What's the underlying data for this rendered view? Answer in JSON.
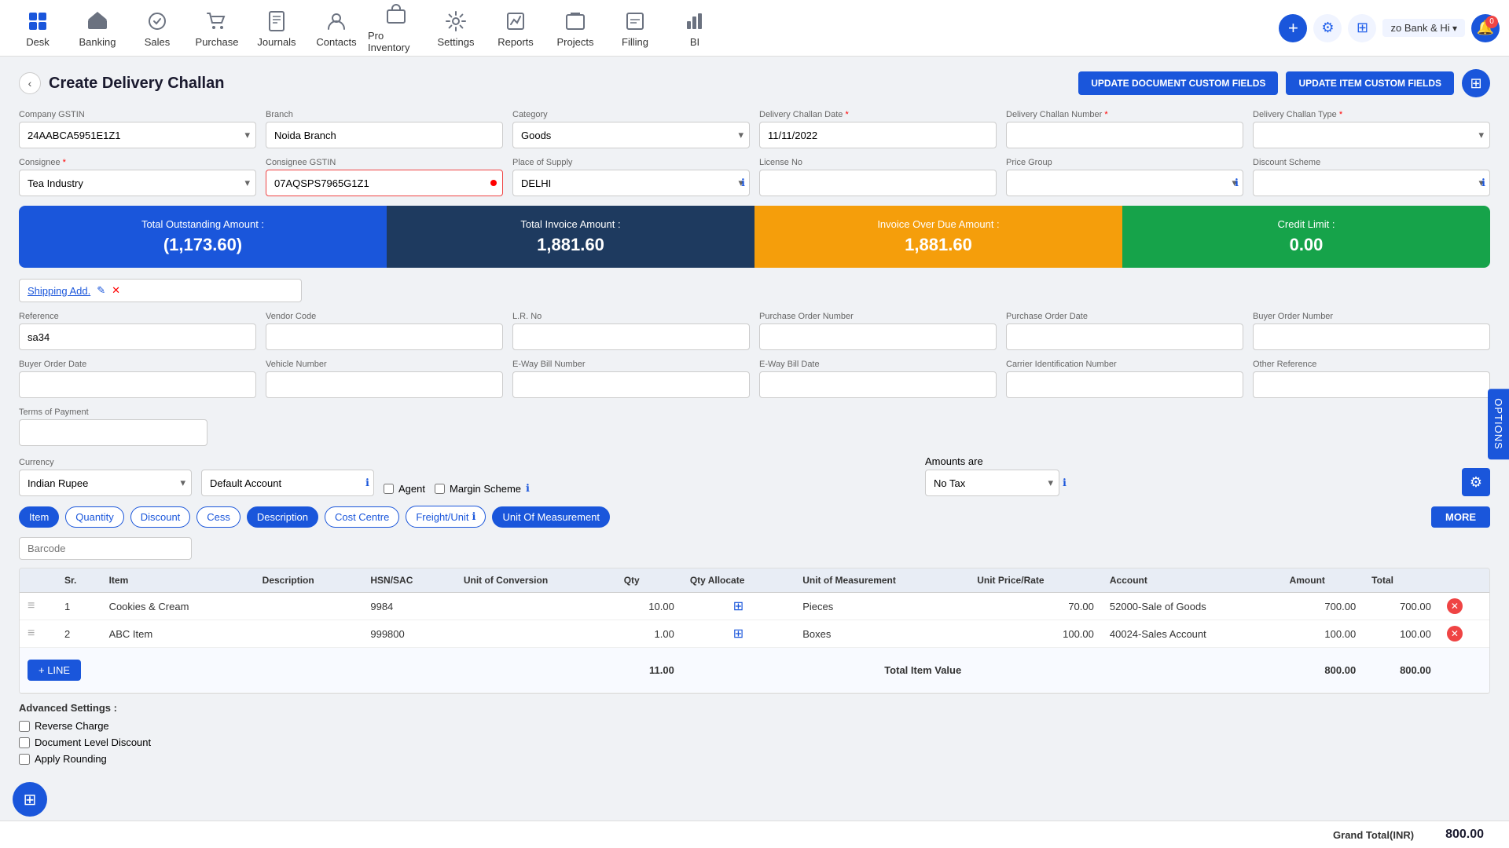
{
  "nav": {
    "items": [
      {
        "id": "desk",
        "label": "Desk",
        "icon": "🏠"
      },
      {
        "id": "banking",
        "label": "Banking",
        "icon": "🏦"
      },
      {
        "id": "sales",
        "label": "Sales",
        "icon": "🏷️"
      },
      {
        "id": "purchase",
        "label": "Purchase",
        "icon": "🛒"
      },
      {
        "id": "journals",
        "label": "Journals",
        "icon": "📋"
      },
      {
        "id": "contacts",
        "label": "Contacts",
        "icon": "👤"
      },
      {
        "id": "pro-inventory",
        "label": "Pro Inventory",
        "icon": "📦"
      },
      {
        "id": "settings",
        "label": "Settings",
        "icon": "⚙️"
      },
      {
        "id": "reports",
        "label": "Reports",
        "icon": "📊"
      },
      {
        "id": "projects",
        "label": "Projects",
        "icon": "📁"
      },
      {
        "id": "filling",
        "label": "Filling",
        "icon": "🗂️"
      },
      {
        "id": "bi",
        "label": "BI",
        "icon": "📈"
      }
    ],
    "company": "zo Bank & Hi",
    "badge_count": "0"
  },
  "page": {
    "title": "Create Delivery Challan",
    "back_label": "‹"
  },
  "buttons": {
    "update_doc": "UPDATE DOCUMENT CUSTOM FIELDS",
    "update_item": "UPDATE ITEM CUSTOM FIELDS",
    "options": "OPTIONS",
    "more": "MORE",
    "add_line": "+ LINE"
  },
  "form": {
    "company_gstin_label": "Company GSTIN",
    "company_gstin_value": "24AABCA5951E1Z1",
    "branch_label": "Branch",
    "branch_value": "Noida Branch",
    "category_label": "Category",
    "category_value": "Goods",
    "delivery_challan_date_label": "Delivery Challan Date",
    "delivery_challan_date_value": "11/11/2022",
    "delivery_challan_number_label": "Delivery Challan Number",
    "delivery_challan_number_value": "",
    "delivery_challan_type_label": "Delivery Challan Type",
    "delivery_challan_type_value": "",
    "consignee_label": "Consignee",
    "consignee_value": "Tea Industry",
    "consignee_gstin_label": "Consignee GSTIN",
    "consignee_gstin_value": "07AQSPS7965G1Z1",
    "place_of_supply_label": "Place of Supply",
    "place_of_supply_value": "DELHI",
    "license_no_label": "License No",
    "license_no_value": "",
    "price_group_label": "Price Group",
    "price_group_value": "",
    "discount_scheme_label": "Discount Scheme",
    "discount_scheme_value": "",
    "reference_label": "Reference",
    "reference_value": "sa34",
    "vendor_code_label": "Vendor Code",
    "vendor_code_value": "",
    "lr_no_label": "L.R. No",
    "lr_no_value": "",
    "purchase_order_number_label": "Purchase Order Number",
    "purchase_order_number_value": "",
    "purchase_order_date_label": "Purchase Order Date",
    "purchase_order_date_value": "",
    "buyer_order_number_label": "Buyer Order Number",
    "buyer_order_number_value": "",
    "buyer_order_date_label": "Buyer Order Date",
    "buyer_order_date_value": "",
    "vehicle_number_label": "Vehicle Number",
    "vehicle_number_value": "",
    "eway_bill_number_label": "E-Way Bill Number",
    "eway_bill_number_value": "",
    "eway_bill_date_label": "E-Way Bill Date",
    "eway_bill_date_value": "",
    "carrier_id_label": "Carrier Identification Number",
    "carrier_id_value": "",
    "other_reference_label": "Other Reference",
    "other_reference_value": "",
    "terms_of_payment_label": "Terms of Payment",
    "terms_of_payment_value": "",
    "currency_label": "Currency",
    "currency_value": "Indian Rupee",
    "default_account_value": "Default Account",
    "agent_label": "Agent",
    "margin_scheme_label": "Margin Scheme",
    "amounts_are_label": "Amounts are",
    "amounts_are_value": "No Tax",
    "barcode_placeholder": "Barcode",
    "shipping_label": "Shipping Add."
  },
  "stats": {
    "total_outstanding_label": "Total Outstanding Amount :",
    "total_outstanding_value": "(1,173.60)",
    "total_invoice_label": "Total Invoice Amount :",
    "total_invoice_value": "1,881.60",
    "invoice_overdue_label": "Invoice Over Due Amount :",
    "invoice_overdue_value": "1,881.60",
    "credit_limit_label": "Credit Limit :",
    "credit_limit_value": "0.00"
  },
  "columns": {
    "tabs": [
      {
        "id": "item",
        "label": "Item",
        "active": true
      },
      {
        "id": "quantity",
        "label": "Quantity",
        "active": false
      },
      {
        "id": "discount",
        "label": "Discount",
        "active": false
      },
      {
        "id": "cess",
        "label": "Cess",
        "active": false
      },
      {
        "id": "description",
        "label": "Description",
        "active": true
      },
      {
        "id": "cost-centre",
        "label": "Cost Centre",
        "active": false
      },
      {
        "id": "freight-unit",
        "label": "Freight/Unit",
        "active": false,
        "has_info": true
      },
      {
        "id": "uom",
        "label": "Unit Of Measurement",
        "active": true
      }
    ]
  },
  "table": {
    "headers": [
      "",
      "Sr.",
      "Item",
      "Description",
      "HSN/SAC",
      "Unit of Conversion",
      "Qty",
      "Qty Allocate",
      "Unit of Measurement",
      "Unit Price/Rate",
      "Account",
      "Amount",
      "Total",
      ""
    ],
    "rows": [
      {
        "drag": "≡",
        "sr": "1",
        "item": "Cookies & Cream",
        "description": "",
        "hsn_sac": "9984",
        "unit_conversion": "",
        "qty": "10.00",
        "qty_allocate": "⊞",
        "uom": "Pieces",
        "unit_price": "70.00",
        "account": "52000-Sale of Goods",
        "amount": "700.00",
        "total": "700.00"
      },
      {
        "drag": "≡",
        "sr": "2",
        "item": "ABC Item",
        "description": "",
        "hsn_sac": "999800",
        "unit_conversion": "",
        "qty": "1.00",
        "qty_allocate": "⊞",
        "uom": "Boxes",
        "unit_price": "100.00",
        "account": "40024-Sales Account",
        "amount": "100.00",
        "total": "100.00"
      }
    ],
    "footer": {
      "qty_total": "11.00",
      "total_item_value_label": "Total Item Value",
      "amount_total": "800.00",
      "total": "800.00"
    }
  },
  "advanced": {
    "title": "Advanced Settings :",
    "reverse_charge_label": "Reverse Charge",
    "document_level_discount_label": "Document Level Discount",
    "apply_rounding_label": "Apply Rounding"
  },
  "grand_total": {
    "label": "Grand Total(INR)",
    "value": "800.00"
  }
}
